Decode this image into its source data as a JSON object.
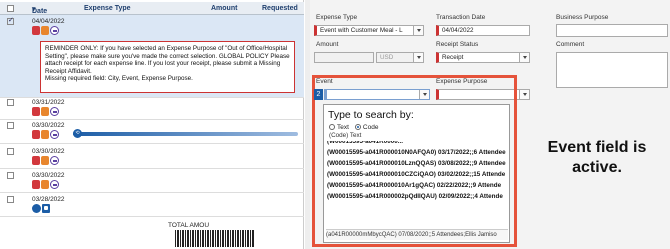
{
  "list_header": {
    "date": "Date",
    "expense_type": "Expense Type",
    "amount": "Amount",
    "requested": "Requested"
  },
  "rows": [
    {
      "date": "04/04/2022",
      "checked": true,
      "selected": true
    },
    {
      "date": "03/31/2022",
      "checked": false
    },
    {
      "date": "03/30/2022",
      "checked": false
    },
    {
      "date": "03/30/2022",
      "checked": false
    },
    {
      "date": "03/30/2022",
      "checked": false
    },
    {
      "date": "03/28/2022",
      "checked": false
    }
  ],
  "reminder": {
    "text": "REMINDER ONLY: If you have selected an Expense Purpose of \"Out of Office/Hospital Setting\", please make sure you've made the correct selection. GLOBAL POLICY Please attach receipt for each expense line. If you lost your receipt, please submit a Missing Receipt Affidavit.",
    "missing": "Missing required field: City, Event, Expense Purpose."
  },
  "progress_percent": 100,
  "total_label": "TOTAL AMOU",
  "form": {
    "expense_type_label": "Expense Type",
    "expense_type_value": "Event with Customer Meal - L",
    "transaction_date_label": "Transaction Date",
    "transaction_date_value": "04/04/2022",
    "business_purpose_label": "Business Purpose",
    "amount_label": "Amount",
    "currency_value": "USD",
    "receipt_status_label": "Receipt Status",
    "receipt_status_value": "Receipt",
    "comment_label": "Comment",
    "event_label": "Event",
    "event_badge": "2",
    "event_value": "",
    "expense_purpose_label": "Expense Purpose"
  },
  "search_popup": {
    "title": "Type to search by:",
    "option_text": "Text",
    "option_code": "Code",
    "selected_option": "Code",
    "hint": "(Code) Text",
    "items": [
      "(W00015595-a041R000010N0AFQA0) 03/17/2022;;6 Attendee",
      "(W00015595-a041R000010LznQQAS) 03/08/2022;;9 Attendee",
      "(W00015595-a041R000010CZCiQAO) 03/02/2022;;15 Attende",
      "(W00015595-a041R000010Ar1gQAC) 02/22/2022;;9 Attende",
      "(W00015595-a041R000002pQdIIQAU) 02/09/2022;;4 Attende"
    ],
    "footer": "(a041R00000mMbycQAC) 07/08/2020;;5 Attendees;Ellis Jamiso"
  },
  "callout": "Event field is active.",
  "colors": {
    "highlight": "#e5533b",
    "accent": "#1c5da6",
    "required": "#cc3333"
  }
}
